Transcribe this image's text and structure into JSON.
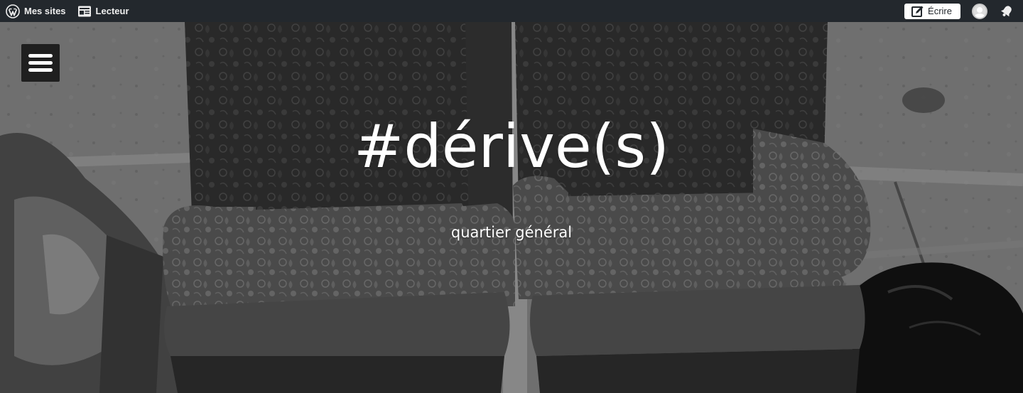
{
  "adminbar": {
    "my_sites_label": "Mes sites",
    "reader_label": "Lecteur",
    "write_label": "Écrire",
    "icons": {
      "wordpress": "wordpress-logo-icon",
      "reader": "reader-icon",
      "write": "edit-icon",
      "avatar": "user-avatar",
      "notifications": "notifications-bell-icon"
    },
    "colors": {
      "background": "#23282d",
      "text": "#eeeeee"
    }
  },
  "header": {
    "menu_icon": "hamburger-menu-icon",
    "site_title": "#dérive(s)",
    "site_description": "quartier général",
    "image_description": "black-and-white photo of two worn floral armchairs on a sidewalk"
  }
}
